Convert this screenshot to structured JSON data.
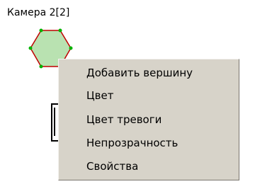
{
  "camera": {
    "label": "Камера 2[2]"
  },
  "zone": {
    "fill_color": "#b9e2b1",
    "edge_color": "#c00000",
    "vertex_color": "#00b300"
  },
  "context_menu": {
    "items": [
      {
        "label": "Добавить вершину"
      },
      {
        "label": "Цвет"
      },
      {
        "label": "Цвет тревоги"
      },
      {
        "label": "Непрозрачность"
      },
      {
        "label": "Свойства"
      }
    ]
  }
}
